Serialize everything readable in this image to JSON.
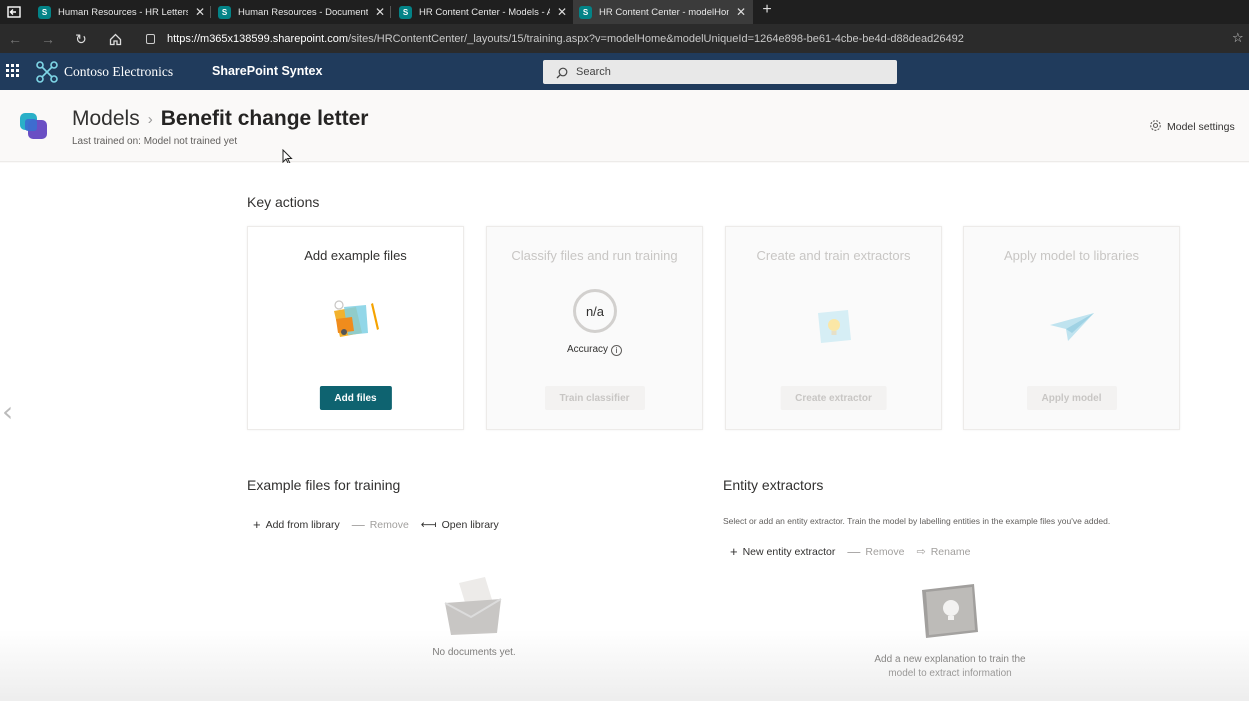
{
  "browser": {
    "tabs": [
      {
        "title": "Human Resources - HR Letters -",
        "active": false
      },
      {
        "title": "Human Resources - Documents",
        "active": false
      },
      {
        "title": "HR Content Center - Models - Al",
        "active": false
      },
      {
        "title": "HR Content Center - modelHom",
        "active": true
      }
    ],
    "url_prefix": "https://",
    "url_host": "m365x138599.sharepoint.com",
    "url_path": "/sites/HRContentCenter/_layouts/15/training.aspx?v=modelHome&modelUniqueId=1264e898-be61-4cbe-be4d-d88dead26492"
  },
  "suitebar": {
    "brand": "Contoso Electronics",
    "app": "SharePoint Syntex",
    "search_placeholder": "Search",
    "bg_color": "#203b5c"
  },
  "header": {
    "breadcrumb_root": "Models",
    "breadcrumb_current": "Benefit change letter",
    "last_trained": "Last trained on: Model not trained yet",
    "settings_label": "Model settings"
  },
  "key_actions": {
    "heading": "Key actions",
    "cards": [
      {
        "title": "Add example files",
        "button": "Add files",
        "enabled": true
      },
      {
        "title": "Classify files and run training",
        "accuracy_value": "n/a",
        "accuracy_label": "Accuracy",
        "button": "Train classifier",
        "enabled": false
      },
      {
        "title": "Create and train extractors",
        "button": "Create extractor",
        "enabled": false
      },
      {
        "title": "Apply model to libraries",
        "button": "Apply model",
        "enabled": false
      }
    ],
    "primary_color": "#0e6370"
  },
  "example_files": {
    "heading": "Example files for training",
    "commands": {
      "add": "Add from library",
      "remove": "Remove",
      "open": "Open library"
    },
    "empty_text": "No documents yet."
  },
  "entity_extractors": {
    "heading": "Entity extractors",
    "description": "Select or add an entity extractor. Train the model by labelling entities in the example files you've added.",
    "commands": {
      "new": "New entity extractor",
      "remove": "Remove",
      "rename": "Rename"
    },
    "empty_text_line1": "Add a new explanation to train the",
    "empty_text_line2": "model to extract information"
  }
}
